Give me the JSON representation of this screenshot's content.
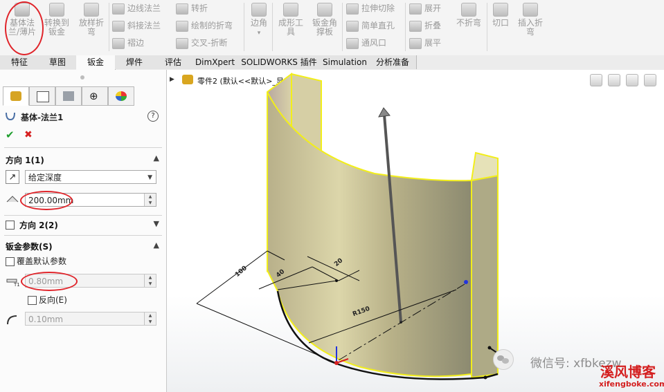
{
  "ribbon": {
    "large_buttons": [
      {
        "label_line1": "基体法",
        "label_line2": "兰/薄片",
        "icon": "base-flange-icon"
      },
      {
        "label_line1": "转换到",
        "label_line2": "钣金",
        "icon": "convert-to-sheetmetal-icon"
      },
      {
        "label_line1": "放样折",
        "label_line2": "弯",
        "icon": "lofted-bend-icon"
      },
      {
        "label_line1": "边角",
        "label_line2": "",
        "icon": "corners-icon"
      },
      {
        "label_line1": "成形工",
        "label_line2": "具",
        "icon": "forming-tool-icon"
      },
      {
        "label_line1": "钣金角",
        "label_line2": "撑板",
        "icon": "gusset-icon"
      },
      {
        "label_line1": "不折弯",
        "label_line2": "",
        "icon": "no-bends-icon"
      },
      {
        "label_line1": "切口",
        "label_line2": "",
        "icon": "rip-icon"
      },
      {
        "label_line1": "插入折",
        "label_line2": "弯",
        "icon": "insert-bends-icon"
      }
    ],
    "small_buttons": [
      {
        "label": "边线法兰",
        "icon": "edge-flange-icon"
      },
      {
        "label": "斜接法兰",
        "icon": "miter-flange-icon"
      },
      {
        "label": "褶边",
        "icon": "hem-icon"
      },
      {
        "label": "转折",
        "icon": "jog-icon"
      },
      {
        "label": "绘制的折弯",
        "icon": "sketched-bend-icon"
      },
      {
        "label": "交叉-折断",
        "icon": "cross-break-icon"
      },
      {
        "label": "拉伸切除",
        "icon": "extruded-cut-icon"
      },
      {
        "label": "简单直孔",
        "icon": "simple-hole-icon"
      },
      {
        "label": "通风口",
        "icon": "vent-icon"
      },
      {
        "label": "展开",
        "icon": "unfold-icon"
      },
      {
        "label": "折叠",
        "icon": "fold-icon"
      },
      {
        "label": "展平",
        "icon": "flatten-icon"
      }
    ]
  },
  "tabs": [
    "特征",
    "草图",
    "钣金",
    "焊件",
    "评估",
    "DimXpert",
    "SOLIDWORKS 插件",
    "Simulation",
    "分析准备"
  ],
  "panel": {
    "title": "基体-法兰1",
    "help": "?",
    "ok": "✔",
    "cancel": "✖",
    "direction1": {
      "title": "方向 1(1)",
      "end_condition": "给定深度",
      "depth": "200.00mm"
    },
    "direction2": {
      "title": "方向 2(2)"
    },
    "sheetmetal": {
      "title": "钣金参数(S)",
      "override_label": "覆盖默认参数",
      "thickness": "0.80mm",
      "reverse_label": "反向(E)",
      "bend_radius": "0.10mm"
    }
  },
  "viewport": {
    "tree_label": "零件2 (默认<<默认>_显...",
    "dims": {
      "d100": "100",
      "d40": "40",
      "d20": "20",
      "radius": "R150"
    },
    "watermark": {
      "wechat": "微信号: xfbkezw",
      "logo": "溪风博客",
      "url": "xifengboke.com"
    },
    "colors": {
      "body": "#c9c28c",
      "edge": "#f2ee1a",
      "watermark_red": "#d41f1f"
    }
  }
}
